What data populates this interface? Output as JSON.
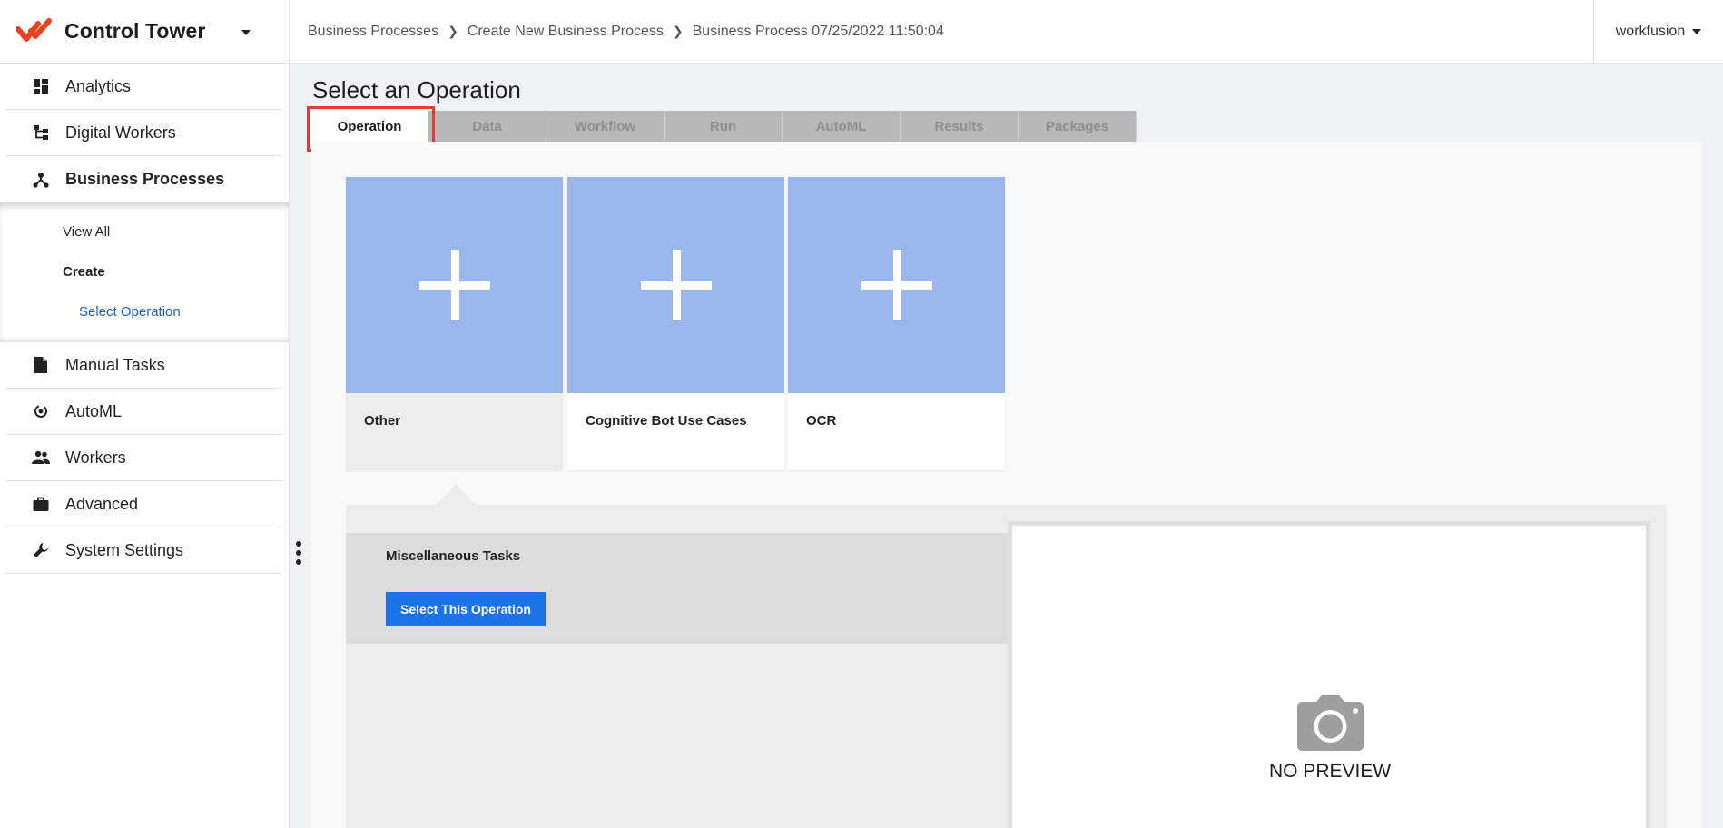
{
  "app": {
    "title": "Control Tower"
  },
  "sidebar": {
    "items": [
      {
        "label": "Analytics",
        "icon": "dashboard-icon"
      },
      {
        "label": "Digital Workers",
        "icon": "hierarchy-icon"
      },
      {
        "label": "Business Processes",
        "icon": "process-icon",
        "active": true
      },
      {
        "label": "Manual Tasks",
        "icon": "document-icon"
      },
      {
        "label": "AutoML",
        "icon": "automl-icon"
      },
      {
        "label": "Workers",
        "icon": "people-icon"
      },
      {
        "label": "Advanced",
        "icon": "briefcase-icon"
      },
      {
        "label": "System Settings",
        "icon": "wrench-icon"
      }
    ],
    "sub": {
      "view_all": "View All",
      "create": "Create",
      "select_operation": "Select Operation"
    }
  },
  "breadcrumb": [
    "Business Processes",
    "Create New Business Process",
    "Business Process 07/25/2022 11:50:04"
  ],
  "user": {
    "name": "workfusion"
  },
  "main": {
    "title": "Select an Operation",
    "tabs": [
      "Operation",
      "Data",
      "Workflow",
      "Run",
      "AutoML",
      "Results",
      "Packages"
    ],
    "active_tab": "Operation",
    "cards": [
      {
        "label": "Other",
        "selected": true
      },
      {
        "label": "Cognitive Bot Use Cases"
      },
      {
        "label": "OCR"
      }
    ],
    "detail": {
      "name": "Miscellaneous Tasks",
      "button": "Select This Operation",
      "preview_text": "NO PREVIEW"
    }
  },
  "colors": {
    "accent": "#1a73e8",
    "card_image": "#99b7ec",
    "link": "#1a5fcc",
    "highlight": "#e53935"
  }
}
